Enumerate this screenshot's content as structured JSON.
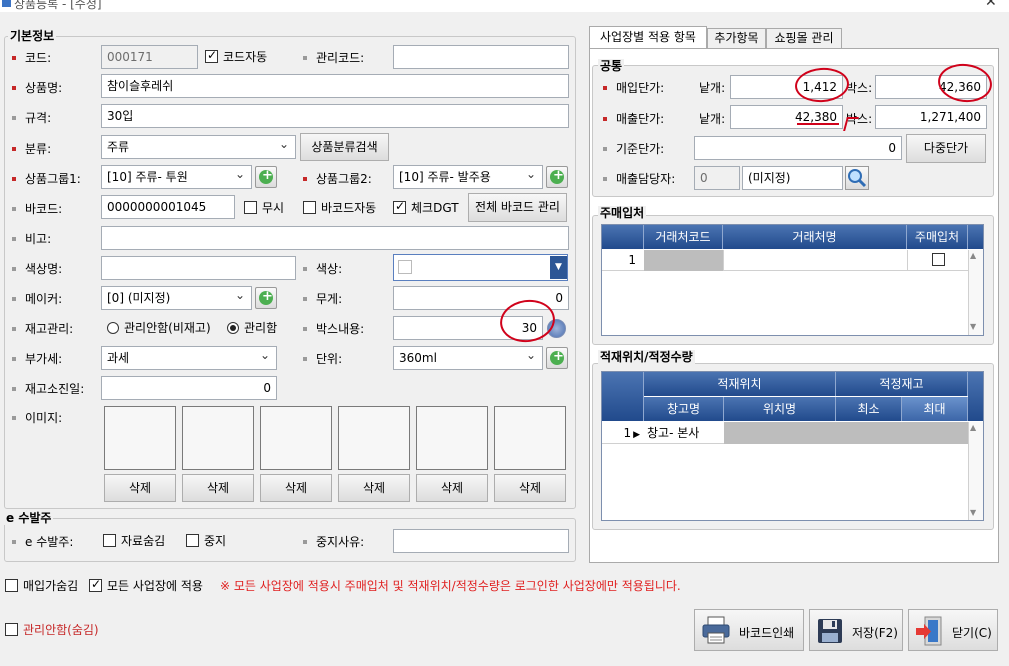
{
  "window": {
    "title": "상품등록 - [수정]"
  },
  "basic": {
    "section_title": "기본정보",
    "code": {
      "label": "코드:",
      "value": "000171",
      "auto_label": "코드자동",
      "auto_checked": true
    },
    "mgmt_code": {
      "label": "관리코드:",
      "value": ""
    },
    "name": {
      "label": "상품명:",
      "value": "참이슬후레쉬"
    },
    "spec": {
      "label": "규격:",
      "value": "30입"
    },
    "category": {
      "label": "분류:",
      "value": "주류",
      "search_button": "상품분류검색"
    },
    "group1": {
      "label": "상품그룹1:",
      "value": "[10] 주류- 투원"
    },
    "group2": {
      "label": "상품그룹2:",
      "value": "[10] 주류- 발주용"
    },
    "barcode": {
      "label": "바코드:",
      "value": "0000000001045",
      "ignore_label": "무시",
      "auto_label": "바코드자동",
      "check_label": "체크DGT",
      "manage_button": "전체 바코드 관리"
    },
    "memo": {
      "label": "비고:",
      "value": ""
    },
    "color_name": {
      "label": "색상명:",
      "value": ""
    },
    "color": {
      "label": "색상:"
    },
    "maker": {
      "label": "메이커:",
      "value": "[0] (미지정)"
    },
    "weight": {
      "label": "무게:",
      "value": "0"
    },
    "stock_mgmt": {
      "label": "재고관리:",
      "option1": "관리안함(비재고)",
      "option2": "관리함",
      "selected": "관리함"
    },
    "box_content": {
      "label": "박스내용:",
      "value": "30"
    },
    "vat": {
      "label": "부가세:",
      "value": "과세"
    },
    "unit": {
      "label": "단위:",
      "value": "360ml"
    },
    "stock_days": {
      "label": "재고소진일:",
      "value": "0"
    },
    "image": {
      "label": "이미지:",
      "delete_labels": [
        "삭제",
        "삭제",
        "삭제",
        "삭제",
        "삭제",
        "삭제"
      ]
    }
  },
  "eorder": {
    "section_title": "e 수발주",
    "label": "e 수발주:",
    "hide_label": "자료숨김",
    "stop_label": "중지",
    "reason_label": "중지사유:",
    "reason_value": ""
  },
  "bottom": {
    "hide_buy_label": "매입가숨김",
    "apply_all_label": "모든 사업장에 적용",
    "notice": "※ 모든 사업장에 적용시 주매입처 및 적재위치/적정수량은 로그인한 사업장에만 적용됩니다.",
    "unmanaged_label": "관리안함(숨김)",
    "print_button": "바코드인쇄",
    "save_button": "저장(F2)",
    "close_button": "닫기(C)"
  },
  "tabs": [
    "사업장별 적용 항목",
    "추가항목",
    "쇼핑몰 관리"
  ],
  "common": {
    "section_title": "공통",
    "buy_price": {
      "label": "매입단가:",
      "unit_label": "낱개:",
      "unit_value": "1,412",
      "box_label": "박스:",
      "box_value": "42,360"
    },
    "sell_price": {
      "label": "매출단가:",
      "unit_label": "낱개:",
      "unit_value": "42,380",
      "box_label": "박스:",
      "box_value": "1,271,400"
    },
    "base_price": {
      "label": "기준단가:",
      "value": "0",
      "multi_button": "다중단가"
    },
    "sales_rep": {
      "label": "매출담당자:",
      "code": "0",
      "name": "(미지정)"
    }
  },
  "supplier": {
    "section_title": "주매입처",
    "columns": [
      "거래처코드",
      "거래처명",
      "주매입처"
    ],
    "rows": [
      {
        "no": "1",
        "code": "",
        "name": "",
        "main": false
      }
    ]
  },
  "location": {
    "section_title": "적재위치/적정수량",
    "group_headers": [
      "적재위치",
      "적정재고"
    ],
    "columns": [
      "창고명",
      "위치명",
      "최소",
      "최대"
    ],
    "rows": [
      {
        "no": "1",
        "warehouse": "창고- 본사",
        "location": "",
        "min": "",
        "max": ""
      }
    ]
  },
  "colors": {
    "header_blue": "#2c5696",
    "required_bullet": "#c62828",
    "annotation_red": "#d0021b",
    "notice_red": "#e02020"
  }
}
